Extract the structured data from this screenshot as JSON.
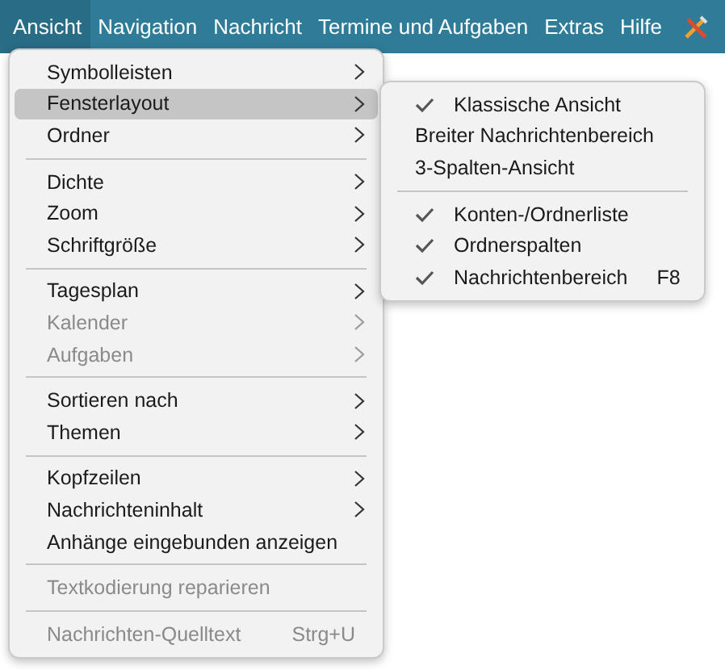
{
  "menubar": {
    "items": [
      {
        "label": "Ansicht",
        "selected": true
      },
      {
        "label": "Navigation",
        "selected": false
      },
      {
        "label": "Nachricht",
        "selected": false
      },
      {
        "label": "Termine und Aufgaben",
        "selected": false
      },
      {
        "label": "Extras",
        "selected": false
      },
      {
        "label": "Hilfe",
        "selected": false
      }
    ]
  },
  "menu": {
    "sections": [
      [
        {
          "label": "Symbolleisten",
          "submenu": true,
          "disabled": false,
          "selected": false
        },
        {
          "label": "Fensterlayout",
          "submenu": true,
          "disabled": false,
          "selected": true
        },
        {
          "label": "Ordner",
          "submenu": true,
          "disabled": false,
          "selected": false
        }
      ],
      [
        {
          "label": "Dichte",
          "submenu": true,
          "disabled": false,
          "selected": false
        },
        {
          "label": "Zoom",
          "submenu": true,
          "disabled": false,
          "selected": false
        },
        {
          "label": "Schriftgröße",
          "submenu": true,
          "disabled": false,
          "selected": false
        }
      ],
      [
        {
          "label": "Tagesplan",
          "submenu": true,
          "disabled": false,
          "selected": false
        },
        {
          "label": "Kalender",
          "submenu": true,
          "disabled": true,
          "selected": false
        },
        {
          "label": "Aufgaben",
          "submenu": true,
          "disabled": true,
          "selected": false
        }
      ],
      [
        {
          "label": "Sortieren nach",
          "submenu": true,
          "disabled": false,
          "selected": false
        },
        {
          "label": "Themen",
          "submenu": true,
          "disabled": false,
          "selected": false
        }
      ],
      [
        {
          "label": "Kopfzeilen",
          "submenu": true,
          "disabled": false,
          "selected": false
        },
        {
          "label": "Nachrichteninhalt",
          "submenu": true,
          "disabled": false,
          "selected": false
        },
        {
          "label": "Anhänge eingebunden anzeigen",
          "submenu": false,
          "disabled": false,
          "selected": false
        }
      ],
      [
        {
          "label": "Textkodierung reparieren",
          "submenu": false,
          "disabled": true,
          "selected": false
        }
      ],
      [
        {
          "label": "Nachrichten-Quelltext",
          "submenu": false,
          "disabled": true,
          "selected": false,
          "shortcut": "Strg+U"
        }
      ]
    ]
  },
  "submenu": {
    "sections": [
      [
        {
          "label": "Klassische Ansicht",
          "checked": true
        },
        {
          "label": "Breiter Nachrichtenbereich",
          "checked": false
        },
        {
          "label": "3-Spalten-Ansicht",
          "checked": false
        }
      ],
      [
        {
          "label": "Konten-/Ordnerliste",
          "checked": true
        },
        {
          "label": "Ordnerspalten",
          "checked": true
        },
        {
          "label": "Nachrichtenbereich",
          "checked": true,
          "shortcut": "F8"
        }
      ]
    ]
  }
}
